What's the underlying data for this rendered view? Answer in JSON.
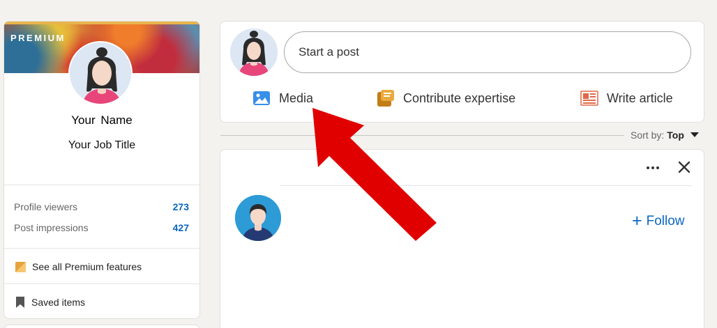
{
  "profile": {
    "banner_label": "PREMIUM",
    "name": "Your  Name",
    "job_title": "Your Job Title",
    "stats": [
      {
        "label": "Profile viewers",
        "value": "273"
      },
      {
        "label": "Post impressions",
        "value": "427"
      }
    ],
    "links": [
      {
        "label": "See all Premium features",
        "icon": "premium-icon"
      },
      {
        "label": "Saved items",
        "icon": "bookmark-icon"
      }
    ]
  },
  "share_box": {
    "placeholder": "Start a post",
    "actions": [
      {
        "label": "Media",
        "icon": "image-icon",
        "color": "#378fe9"
      },
      {
        "label": "Contribute expertise",
        "icon": "contribute-icon",
        "color": "#c37d16"
      },
      {
        "label": "Write article",
        "icon": "article-icon",
        "color": "#e06847"
      }
    ]
  },
  "feed": {
    "sort_label": "Sort by:",
    "sort_value": "Top",
    "follow_label": "Follow",
    "follow_prefix": "+"
  },
  "colors": {
    "link_blue": "#0a66c2",
    "annotation_red": "#e00000",
    "background": "#f3f2ef"
  }
}
